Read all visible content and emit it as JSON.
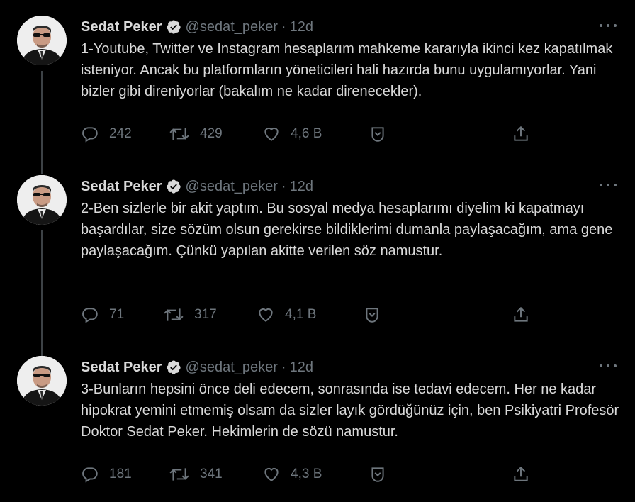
{
  "tweets": [
    {
      "name": "Sedat Peker",
      "handle": "@sedat_peker",
      "separator": "·",
      "time": "12d",
      "text": "1-Youtube, Twitter ve Instagram hesaplarım mahkeme kararıyla ikinci kez kapatılmak isteniyor. Ancak bu platformların yöneticileri hali hazırda bunu uygulamıyorlar. Yani bizler gibi direniyorlar (bakalım ne kadar direnecekler).",
      "replies": "242",
      "retweets": "429",
      "likes": "4,6 B"
    },
    {
      "name": "Sedat Peker",
      "handle": "@sedat_peker",
      "separator": "·",
      "time": "12d",
      "text": "2-Ben sizlerle bir akit yaptım. Bu sosyal medya hesaplarımı diyelim ki kapatmayı başardılar, size sözüm olsun gerekirse bildiklerimi dumanla paylaşacağım, ama gene paylaşacağım. Çünkü yapılan akitte verilen söz namustur.",
      "replies": "71",
      "retweets": "317",
      "likes": "4,1 B"
    },
    {
      "name": "Sedat Peker",
      "handle": "@sedat_peker",
      "separator": "·",
      "time": "12d",
      "text": "3-Bunların hepsini önce deli edecem, sonrasında ise tedavi edecem. Her ne kadar hipokrat yemini etmemiş olsam da sizler layık gördüğünüz için, ben Psikiyatri Profesör Doktor Sedat Peker. Hekimlerin de sözü namustur.",
      "replies": "181",
      "retweets": "341",
      "likes": "4,3 B"
    }
  ],
  "icons": {
    "verified": "verified-badge-icon",
    "more": "more-dots-icon",
    "reply": "reply-icon",
    "retweet": "retweet-icon",
    "like": "like-icon",
    "bookmark": "bookmark-icon",
    "share": "share-icon"
  },
  "colors": {
    "background": "#000000",
    "text": "#d9d9d9",
    "muted": "#6e767d",
    "thread_line": "#3d4246"
  }
}
